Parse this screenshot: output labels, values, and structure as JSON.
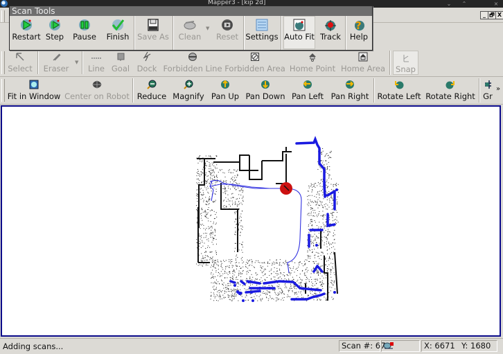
{
  "window": {
    "title": "Mapper3 - [kip 2d]",
    "controls": {
      "minimize": "_",
      "restore": "🗗",
      "close": "X"
    },
    "wm_controls": {
      "down": "⌄",
      "up": "⌃",
      "close": "×"
    }
  },
  "scan_tools": {
    "title": "Scan Tools",
    "buttons": [
      {
        "label": "Restart",
        "icon": "restart-icon",
        "enabled": true
      },
      {
        "label": "Step",
        "icon": "step-icon",
        "enabled": true
      },
      {
        "label": "Pause",
        "icon": "pause-icon",
        "enabled": true
      },
      {
        "label": "Finish",
        "icon": "finish-check-icon",
        "enabled": true
      },
      {
        "label": "Save As",
        "icon": "floppy-icon",
        "enabled": false
      },
      {
        "label": "Clean",
        "icon": "broom-icon",
        "enabled": false
      },
      {
        "label": "Reset",
        "icon": "reset-icon",
        "enabled": false
      },
      {
        "label": "Settings",
        "icon": "settings-icon",
        "enabled": true
      },
      {
        "label": "Auto Fit",
        "icon": "autofit-icon",
        "enabled": true,
        "active": true
      },
      {
        "label": "Track",
        "icon": "track-icon",
        "enabled": true
      },
      {
        "label": "Help",
        "icon": "help-icon",
        "enabled": true
      }
    ]
  },
  "edit_toolbar": {
    "buttons": [
      {
        "label": "Select",
        "icon": "arrow-cursor-icon",
        "enabled": false
      },
      {
        "label": "Eraser",
        "icon": "eraser-icon",
        "enabled": false
      },
      {
        "label": "Line",
        "icon": "line-icon",
        "enabled": false
      },
      {
        "label": "Goal",
        "icon": "goal-icon",
        "enabled": false
      },
      {
        "label": "Dock",
        "icon": "dock-icon",
        "enabled": false
      },
      {
        "label": "Forbidden Line",
        "icon": "forbidden-line-icon",
        "enabled": false
      },
      {
        "label": "Forbidden Area",
        "icon": "forbidden-area-icon",
        "enabled": false
      },
      {
        "label": "Home Point",
        "icon": "home-point-icon",
        "enabled": false
      },
      {
        "label": "Home Area",
        "icon": "home-area-icon",
        "enabled": false
      },
      {
        "label": "Snap",
        "icon": "snap-icon",
        "enabled": false
      }
    ]
  },
  "view_toolbar": {
    "buttons": [
      {
        "label": "Fit in Window",
        "icon": "fit-window-icon",
        "enabled": true
      },
      {
        "label": "Center on Robot",
        "icon": "center-robot-icon",
        "enabled": false
      },
      {
        "label": "Reduce",
        "icon": "zoom-out-icon",
        "enabled": true
      },
      {
        "label": "Magnify",
        "icon": "zoom-in-icon",
        "enabled": true
      },
      {
        "label": "Pan Up",
        "icon": "pan-up-icon",
        "enabled": true
      },
      {
        "label": "Pan Down",
        "icon": "pan-down-icon",
        "enabled": true
      },
      {
        "label": "Pan Left",
        "icon": "pan-left-icon",
        "enabled": true
      },
      {
        "label": "Pan Right",
        "icon": "pan-right-icon",
        "enabled": true
      },
      {
        "label": "Rotate Left",
        "icon": "rotate-left-icon",
        "enabled": true
      },
      {
        "label": "Rotate Right",
        "icon": "rotate-right-icon",
        "enabled": true
      },
      {
        "label": "Gr",
        "icon": "grid-icon",
        "enabled": true
      }
    ],
    "overflow": "»"
  },
  "map": {
    "robot_color": "#cc1111",
    "path_color": "#3030e0",
    "new_scan_color": "#1a1ae0",
    "old_scan_color": "#000000",
    "frame_color": "#0a0a8a"
  },
  "status_bar": {
    "message": "Adding scans...",
    "scan_number": "Scan #: 67",
    "x": "X: 6671",
    "y": "Y: 1680"
  }
}
